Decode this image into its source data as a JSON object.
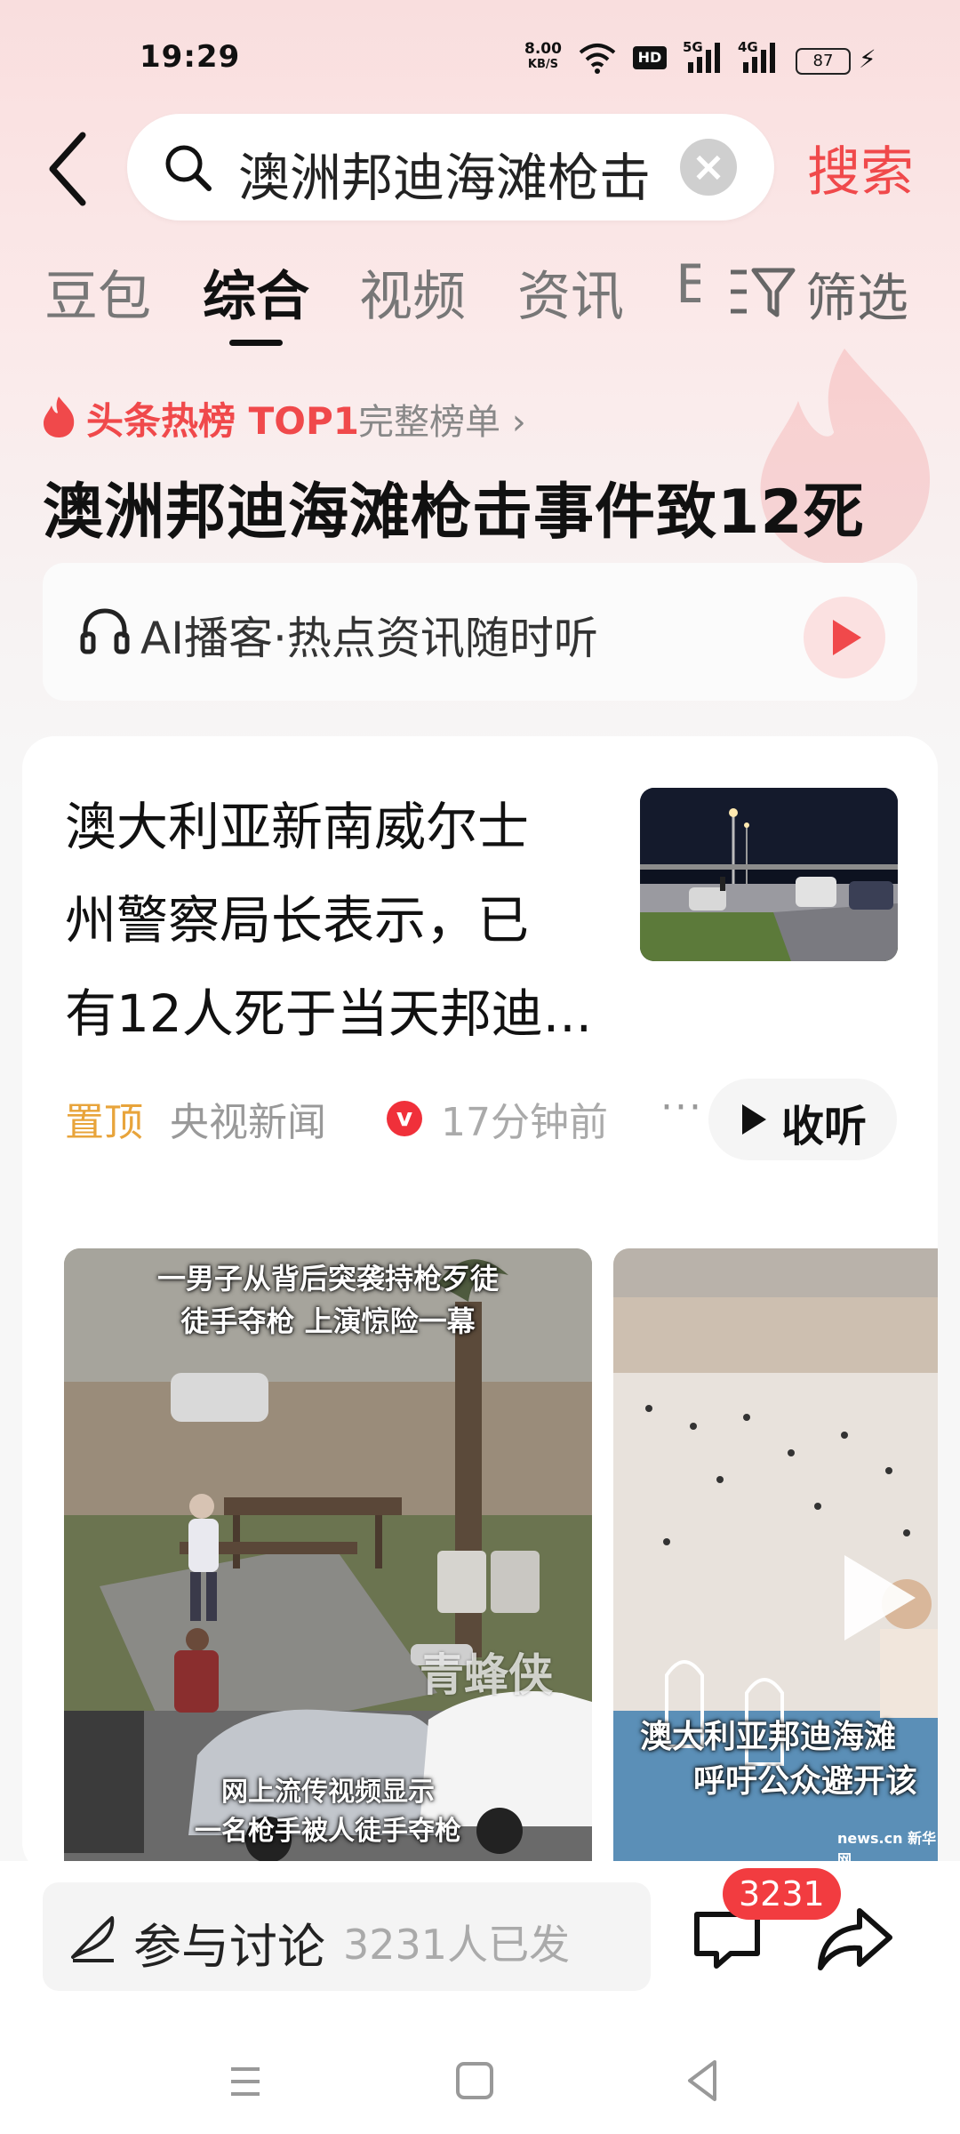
{
  "status_bar": {
    "time": "19:29",
    "net_speed_value": "8.00",
    "net_speed_unit": "KB/S",
    "hd_label": "HD",
    "signal1_label": "5G",
    "signal2_label": "4G",
    "battery": "87"
  },
  "search": {
    "query": "澳洲邦迪海滩枪击",
    "button_label": "搜索"
  },
  "tabs": [
    {
      "label": "豆包"
    },
    {
      "label": "综合"
    },
    {
      "label": "视频"
    },
    {
      "label": "资讯"
    },
    {
      "label": "E"
    }
  ],
  "active_tab": "综合",
  "filter_label": "筛选",
  "hot": {
    "badge": "头条热榜 TOP1",
    "full_list": "完整榜单 ›",
    "title": "澳洲邦迪海滩枪击事件致12死"
  },
  "ai_podcast": {
    "label": "AI播客·热点资讯随时听"
  },
  "news": {
    "title_lines": [
      "澳大利亚新南威尔士",
      "州警察局长表示，已",
      "有12人死于当天邦迪..."
    ],
    "pin_label": "置顶",
    "source": "央视新闻",
    "verified": "v",
    "time_ago": "17分钟前",
    "more": "···",
    "listen_label": "收听"
  },
  "videos": [
    {
      "top_caption_1": "一男子从背后突袭持枪歹徒",
      "top_caption_2": "徒手夺枪 上演惊险一幕",
      "watermark": "青蜂侠",
      "bottom_caption_1": "网上流传视频显示",
      "bottom_caption_2": "一名枪手被人徒手夺枪"
    },
    {
      "caption_1": "澳大利亚邦迪海滩",
      "caption_2": "呼吁公众避开该",
      "watermark": "news.cn 新华网"
    }
  ],
  "bottom": {
    "discuss_label": "参与讨论",
    "discuss_count": "3231人已发",
    "comment_badge": "3231"
  },
  "colors": {
    "accent_red": "#f0494b",
    "pin_orange": "#e8a43b"
  }
}
